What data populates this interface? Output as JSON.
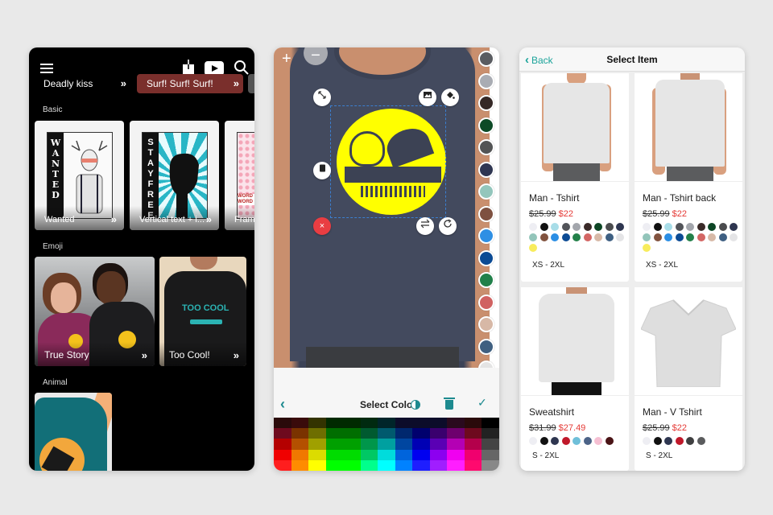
{
  "phone1": {
    "chips": [
      {
        "label": "Deadly kiss"
      },
      {
        "label": "Surf! Surf! Surf!"
      }
    ],
    "chevron": "»",
    "sections": [
      {
        "label": "Basic",
        "cards": [
          {
            "label": "Wanted",
            "art_text": "WANTED"
          },
          {
            "label": "Vertical text + i...",
            "art_text": "STAYFREE"
          },
          {
            "label": "Fram",
            "art_text": "WORD"
          }
        ]
      },
      {
        "label": "Emoji",
        "cards": [
          {
            "label": "True Story"
          },
          {
            "label": "Too Cool!",
            "art_text": "TOO COOL"
          }
        ]
      },
      {
        "label": "Animal",
        "cards": [
          {
            "label": ""
          }
        ]
      }
    ]
  },
  "phone2": {
    "zoom_in": "+",
    "zoom_out": "−",
    "toolbar": {
      "back": "‹",
      "title": "Select Color",
      "confirm": "✓"
    },
    "swatches": [
      "#5a5c61",
      "#a9acb3",
      "#352826",
      "#0c4a26",
      "#535455",
      "#2f3652",
      "#93c6bc",
      "#7e5140",
      "#2e8fe4",
      "#0a4a94",
      "#21804a",
      "#d06261",
      "#d7b8a6",
      "#3f5f80",
      "#e4e4e4"
    ],
    "palette": [
      [
        "#2a0a0a",
        "#3a0b0b",
        "#333300",
        "#002a00",
        "#002a00",
        "#002a10",
        "#00252a",
        "#0c0c2a",
        "#0c0c2a",
        "#0c0c2a",
        "#2a0a1e",
        "#2a0a0a",
        "#000000"
      ],
      [
        "#6e0a1e",
        "#7a3300",
        "#6e6e00",
        "#006e00",
        "#006e00",
        "#005a30",
        "#005a6e",
        "#00286e",
        "#00006e",
        "#3a006e",
        "#6e006e",
        "#6e0a1e",
        "#222222"
      ],
      [
        "#b40000",
        "#b45000",
        "#a0a000",
        "#00a000",
        "#00a000",
        "#00964b",
        "#00a0a0",
        "#0046a0",
        "#0000b4",
        "#5a00b4",
        "#b400b4",
        "#b4004b",
        "#444444"
      ],
      [
        "#f00000",
        "#f07800",
        "#dcdc00",
        "#00dc00",
        "#00dc00",
        "#00c864",
        "#00dcdc",
        "#0064dc",
        "#0000f0",
        "#8c00f0",
        "#f000f0",
        "#f0006e",
        "#666666"
      ],
      [
        "#ff1e1e",
        "#ff8c00",
        "#ffff00",
        "#00ff00",
        "#00ff00",
        "#00ff8c",
        "#00ffff",
        "#0082ff",
        "#1e1eff",
        "#a01eff",
        "#ff1eff",
        "#ff0a6e",
        "#888888"
      ]
    ]
  },
  "phone3": {
    "nav": {
      "back": "Back",
      "title": "Select Item"
    },
    "products": [
      {
        "name": "Man - Tshirt",
        "old_price": "$25.99",
        "price": "$22",
        "sizes": "XS - 2XL",
        "colors": [
          "#eeeef3",
          "#111111",
          "#a8dde8",
          "#525459",
          "#a3a6ac",
          "#3a2a28",
          "#0d4625",
          "#4b4c4e",
          "#2e3650",
          "#93c5ba",
          "#82533f",
          "#2b8ee4",
          "#0c4b94",
          "#238049",
          "#d36664",
          "#d7b9a7",
          "#3e5f82",
          "#e4e4e6",
          "#f8ec5c"
        ]
      },
      {
        "name": "Man - Tshirt back",
        "old_price": "$25.99",
        "price": "$22",
        "sizes": "XS - 2XL",
        "colors": [
          "#eeeef3",
          "#111111",
          "#a8dde8",
          "#525459",
          "#a3a6ac",
          "#3a2a28",
          "#0d4625",
          "#4b4c4e",
          "#2e3650",
          "#93c5ba",
          "#82533f",
          "#2b8ee4",
          "#0c4b94",
          "#238049",
          "#d36664",
          "#d7b9a7",
          "#3e5f82",
          "#e4e4e6",
          "#f8ec5c"
        ]
      },
      {
        "name": "Sweatshirt",
        "old_price": "$31.99",
        "price": "$27.49",
        "sizes": "S - 2XL",
        "colors": [
          "#eeeef3",
          "#111111",
          "#2e3650",
          "#c0182a",
          "#6fbfd9",
          "#4c6387",
          "#f5bfd2",
          "#4a1416"
        ]
      },
      {
        "name": "Man - V Tshirt",
        "old_price": "$25.99",
        "price": "$22",
        "sizes": "S - 2XL",
        "colors": [
          "#eeeef3",
          "#111111",
          "#2e3650",
          "#c0182a",
          "#3f3f40",
          "#5a5b5d"
        ]
      }
    ]
  }
}
